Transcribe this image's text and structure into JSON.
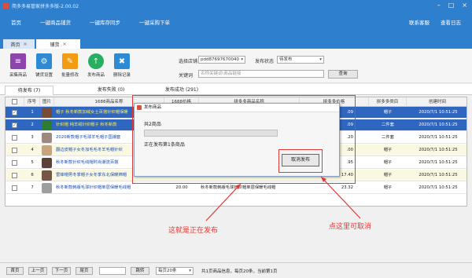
{
  "window": {
    "title": "简多多易管家拼多多版-2.00.02"
  },
  "menu": {
    "items": [
      "首页",
      "一键商品铺货",
      "一键库存同步",
      "一键采购下单"
    ],
    "right": [
      "联系客服",
      "查看日志"
    ]
  },
  "doc_tabs": {
    "home": "首页",
    "active": "铺货",
    "close": "×"
  },
  "toolbar": {
    "buttons": [
      {
        "label": "采集商品",
        "color": "#8e44ad",
        "glyph": "≡"
      },
      {
        "label": "铺货设置",
        "color": "#2d8bd6",
        "glyph": "⚙"
      },
      {
        "label": "批量修改",
        "color": "#f39c12",
        "glyph": "✎"
      },
      {
        "label": "发布商品",
        "color": "#27ae60",
        "glyph": "↑"
      },
      {
        "label": "删除记录",
        "color": "#2d8bd6",
        "glyph": "🗑"
      }
    ],
    "store_label": "选择店铺",
    "store_value": "pdd87697670040",
    "status_label": "发布状态",
    "status_value": "待发布",
    "keyword_label": "关键词",
    "keyword_placeholder": "名称关键词\\商品链接",
    "query_button": "查询"
  },
  "sub_tabs": [
    {
      "label": "待发布",
      "count": "(7)"
    },
    {
      "label": "发布失败",
      "count": "(0)"
    },
    {
      "label": "发布成功",
      "count": "(291)"
    }
  ],
  "table": {
    "columns": [
      "",
      "序号",
      "图片",
      "1688商品名称",
      "1688价格",
      "拼多多商品名称",
      "拼多多价格",
      "拼多多类目",
      "创建时间"
    ],
    "rows": [
      {
        "checked": "✓",
        "no": "1",
        "name_1688": "帽子 秋冬新款加绒女士百搭针织帽保暖",
        "price_1688": "",
        "name_pdd": "",
        "price_pdd": ".09",
        "category": "帽子",
        "time": "2020/7/1 10:51:25",
        "thumb": "#7a4b33",
        "style": "sel"
      },
      {
        "checked": "✓",
        "no": "2",
        "name_1688": "针织帽 纯羊绒针织帽子 秋冬新款",
        "price_1688": "",
        "name_pdd": "",
        "price_pdd": ".09",
        "category": "二件套",
        "time": "2020/7/1 10:51:25",
        "thumb": "#2e7d32",
        "style": "sel"
      },
      {
        "checked": "",
        "no": "3",
        "name_1688": "2020新款帽子毛球羊毛帽子国潮套",
        "price_1688": "",
        "name_pdd": "",
        "price_pdd": ".20",
        "category": "二件套",
        "time": "2020/7/1 10:51:25",
        "thumb": "#a1887f",
        "style": "plain"
      },
      {
        "checked": "",
        "no": "4",
        "name_1688": "翻边皮帽子女冬加毛毛冬羊毛帽针织",
        "price_1688": "",
        "name_pdd": "",
        "price_pdd": ".00",
        "category": "帽子",
        "time": "2020/7/1 10:51:25",
        "thumb": "#c9a27e",
        "style": "alt"
      },
      {
        "checked": "",
        "no": "5",
        "name_1688": "秋冬新款针织毛线帽时尚潮流百搭",
        "price_1688": "",
        "name_pdd": "",
        "price_pdd": ".95",
        "category": "帽子",
        "time": "2020/7/1 10:51:25",
        "thumb": "#5d4037",
        "style": "plain"
      },
      {
        "checked": "",
        "no": "6",
        "name_1688": "雷锋帽男冬季帽子女冬季东北保暖棉帽",
        "price_1688": "14.50",
        "name_pdd": "雷锋帽男雷锋帽子女冬季东北保暖棉帽东北",
        "price_pdd": "17.40",
        "category": "帽子",
        "time": "2020/7/1 10:51:25",
        "thumb": "#795548",
        "style": "alt"
      },
      {
        "checked": "",
        "no": "7",
        "name_1688": "秋冬新款韩版毛球针织帽单层保暖毛线帽",
        "price_1688": "20.00",
        "name_pdd": "秋冬新款韩版毛球针织帽单层保暖毛线帽",
        "price_pdd": "23.32",
        "category": "帽子",
        "time": "2020/7/1 10:51:25",
        "thumb": "#9e9e9e",
        "style": "plain"
      }
    ]
  },
  "dialog": {
    "title": "发布商品",
    "total_text": "共2商品",
    "progress_fraction": 0.0,
    "status_text": "正在发布第1条商品",
    "cancel_button": "取消发布"
  },
  "annotations": {
    "left": "这就是正在发布",
    "right": "点这里可取消"
  },
  "status_bar": {
    "buttons": [
      "首页",
      "上一页",
      "下一页",
      "尾页",
      "跳转"
    ],
    "page_size": "每页20条",
    "summary": "共1页商品信息，每页20条，当前第1页"
  }
}
